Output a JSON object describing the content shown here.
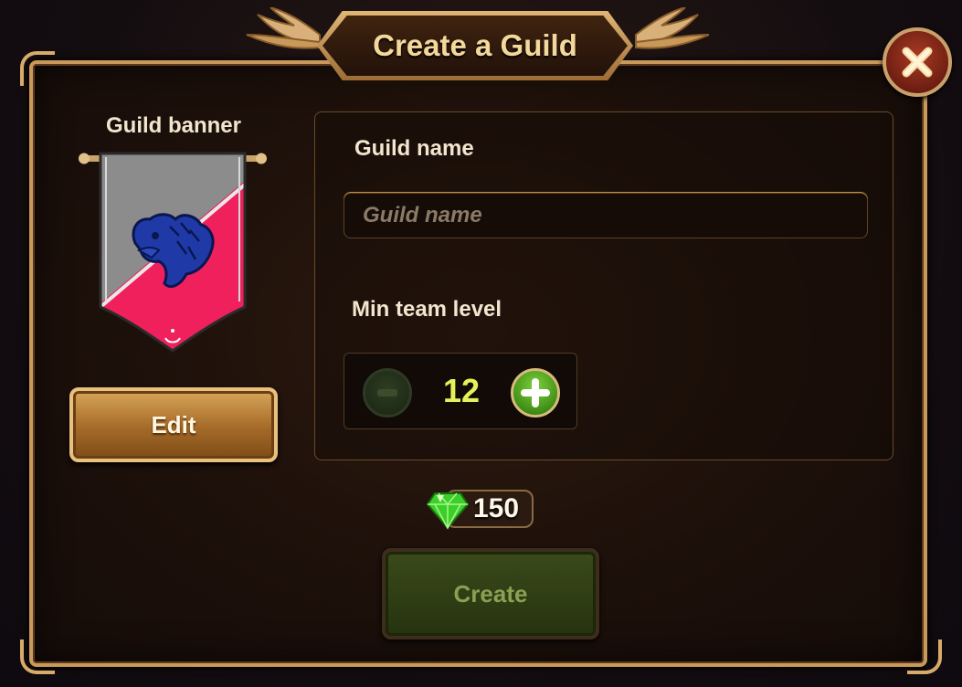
{
  "dialog": {
    "title": "Create a Guild",
    "close_icon": "close-x-icon"
  },
  "banner": {
    "label": "Guild banner",
    "emblem_icon": "eagle-head-icon",
    "colors": {
      "left": "#8c8c8c",
      "right": "#f0205c",
      "emblem": "#1f3aa6"
    },
    "edit_label": "Edit"
  },
  "form": {
    "name_label": "Guild name",
    "name_value": "",
    "name_placeholder": "Guild name",
    "min_level_label": "Min team level",
    "min_level_value": "12",
    "minus_icon": "minus-icon",
    "plus_icon": "plus-icon"
  },
  "cost": {
    "icon": "emerald-gem-icon",
    "amount": "150"
  },
  "create_label": "Create"
}
